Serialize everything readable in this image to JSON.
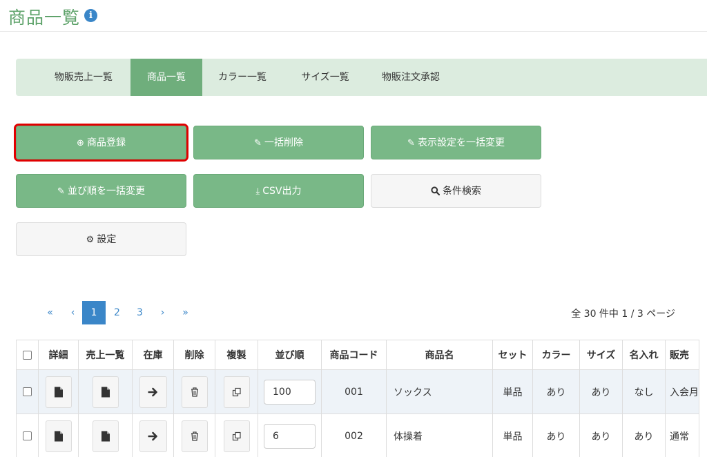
{
  "header": {
    "title": "商品一覧",
    "info_icon": "info-circle-icon"
  },
  "tabs": [
    {
      "label": "物販売上一覧",
      "active": false
    },
    {
      "label": "商品一覧",
      "active": true
    },
    {
      "label": "カラー一覧",
      "active": false
    },
    {
      "label": "サイズ一覧",
      "active": false
    },
    {
      "label": "物販注文承認",
      "active": false
    }
  ],
  "actions": {
    "register": {
      "label": "商品登録",
      "icon": "plus-circle-icon"
    },
    "bulk_delete": {
      "label": "一括削除",
      "icon": "pencil-icon"
    },
    "bulk_display": {
      "label": "表示設定を一括変更",
      "icon": "pencil-icon"
    },
    "bulk_order": {
      "label": "並び順を一括変更",
      "icon": "pencil-icon"
    },
    "csv": {
      "label": "CSV出力",
      "icon": "download-icon"
    },
    "search": {
      "label": "条件検索",
      "icon": "search-icon"
    },
    "settings": {
      "label": "設定",
      "icon": "gear-icon"
    }
  },
  "pagination": {
    "first": "«",
    "prev": "‹",
    "pages": [
      "1",
      "2",
      "3"
    ],
    "current": "1",
    "next": "›",
    "last": "»",
    "info": "全 30 件中 1 / 3 ページ"
  },
  "table": {
    "headers": [
      "詳細",
      "売上一覧",
      "在庫",
      "削除",
      "複製",
      "並び順",
      "商品コード",
      "商品名",
      "セット",
      "カラー",
      "サイズ",
      "名入れ",
      "販売"
    ],
    "rows": [
      {
        "order": "100",
        "code": "001",
        "name": "ソックス",
        "set": "単品",
        "color": "あり",
        "size": "あり",
        "naire": "なし",
        "sales": "入会月"
      },
      {
        "order": "6",
        "code": "002",
        "name": "体操着",
        "set": "単品",
        "color": "あり",
        "size": "あり",
        "naire": "あり",
        "sales": "通常"
      }
    ]
  },
  "colors": {
    "accent_green": "#79b887",
    "tab_bg": "#dcecdf",
    "link_blue": "#3a86c8",
    "highlight_red": "#e00000"
  }
}
